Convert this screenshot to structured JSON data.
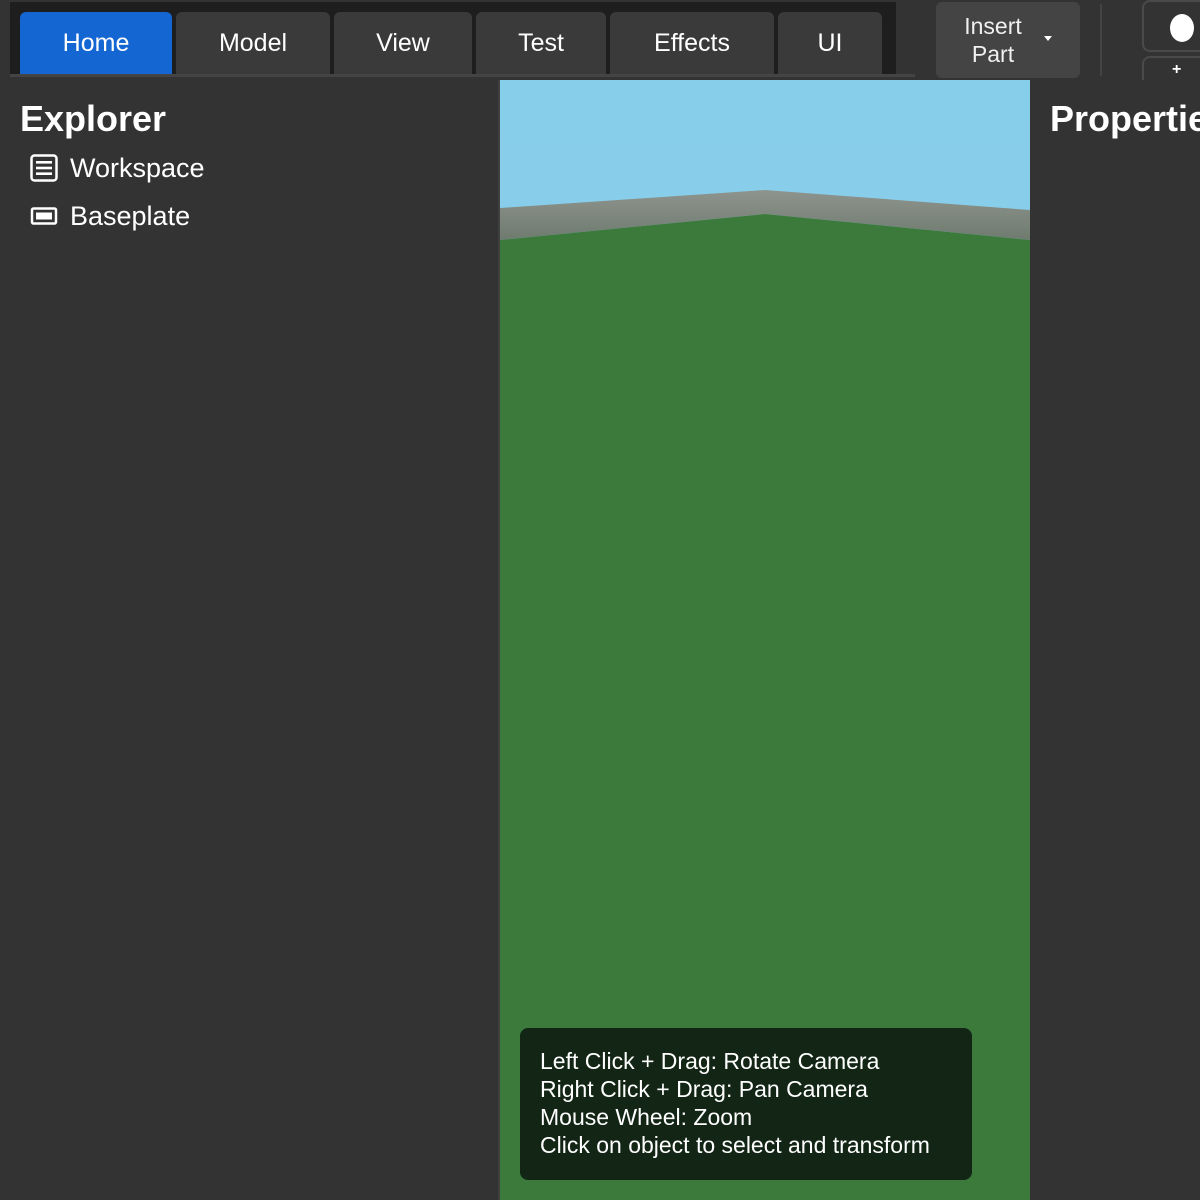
{
  "topbar": {
    "tabs": [
      {
        "label": "Home",
        "active": true
      },
      {
        "label": "Model",
        "active": false
      },
      {
        "label": "View",
        "active": false
      },
      {
        "label": "Test",
        "active": false
      },
      {
        "label": "Effects",
        "active": false
      },
      {
        "label": "UI",
        "active": false
      }
    ],
    "insert_button": {
      "line1": "Insert",
      "line2": "Part",
      "icon": "caret-down-icon"
    },
    "accent_color": "#1466d3"
  },
  "explorer": {
    "title": "Explorer",
    "items": [
      {
        "label": "Workspace",
        "icon": "workspace-icon"
      },
      {
        "label": "Baseplate",
        "icon": "part-icon"
      }
    ]
  },
  "viewport": {
    "sky_color": "#87ceeb",
    "ground_color": "#3c7a3c",
    "hint_lines": [
      "Left Click + Drag: Rotate Camera",
      "Right Click + Drag: Pan Camera",
      "Mouse Wheel: Zoom",
      "Click on object to select and transform"
    ]
  },
  "properties": {
    "title": "Properties"
  }
}
